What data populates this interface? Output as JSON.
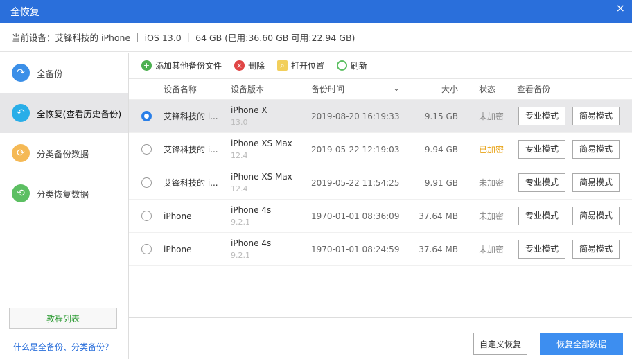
{
  "title": "全恢复",
  "close": "×",
  "device_info": "当前设备：艾锋科技的 iPhone  ｜ iOS 13.0 ｜ 64 GB (已用:36.60 GB 可用:22.94 GB)",
  "sidebar": {
    "items": [
      {
        "label": "全备份",
        "icon": "↷"
      },
      {
        "label": "全恢复(查看历史备份)",
        "icon": "↶"
      },
      {
        "label": "分类备份数据",
        "icon": "⟳"
      },
      {
        "label": "分类恢复数据",
        "icon": "⟲"
      }
    ],
    "tutorial": "教程列表",
    "help_link": "什么是全备份、分类备份？"
  },
  "toolbar": {
    "add": "添加其他备份文件",
    "delete": "删除",
    "open": "打开位置",
    "refresh": "刷新"
  },
  "columns": [
    "设备名称",
    "设备版本",
    "备份时间",
    "大小",
    "状态",
    "查看备份"
  ],
  "sort_icon": "⌄",
  "rows": [
    {
      "name": "艾锋科技的 i...",
      "model": "iPhone X",
      "ios": "13.0",
      "time": "2019-08-20 16:19:33",
      "size": "9.15 GB",
      "status": "未加密",
      "selected": true
    },
    {
      "name": "艾锋科技的 i...",
      "model": "iPhone XS Max",
      "ios": "12.4",
      "time": "2019-05-22 12:19:03",
      "size": "9.94 GB",
      "status": "已加密",
      "selected": false
    },
    {
      "name": "艾锋科技的 i...",
      "model": "iPhone XS Max",
      "ios": "12.4",
      "time": "2019-05-22 11:54:25",
      "size": "9.91 GB",
      "status": "未加密",
      "selected": false
    },
    {
      "name": "iPhone",
      "model": "iPhone 4s",
      "ios": "9.2.1",
      "time": "1970-01-01 08:36:09",
      "size": "37.64 MB",
      "status": "未加密",
      "selected": false
    },
    {
      "name": "iPhone",
      "model": "iPhone 4s",
      "ios": "9.2.1",
      "time": "1970-01-01 08:24:59",
      "size": "37.64 MB",
      "status": "未加密",
      "selected": false
    }
  ],
  "pro_mode": "专业模式",
  "easy_mode": "简易模式",
  "footer": {
    "custom": "自定义恢复",
    "restore_all": "恢复全部数据"
  },
  "colors": {
    "accent": "#2a6fdb",
    "encrypted": "#e8a317"
  }
}
